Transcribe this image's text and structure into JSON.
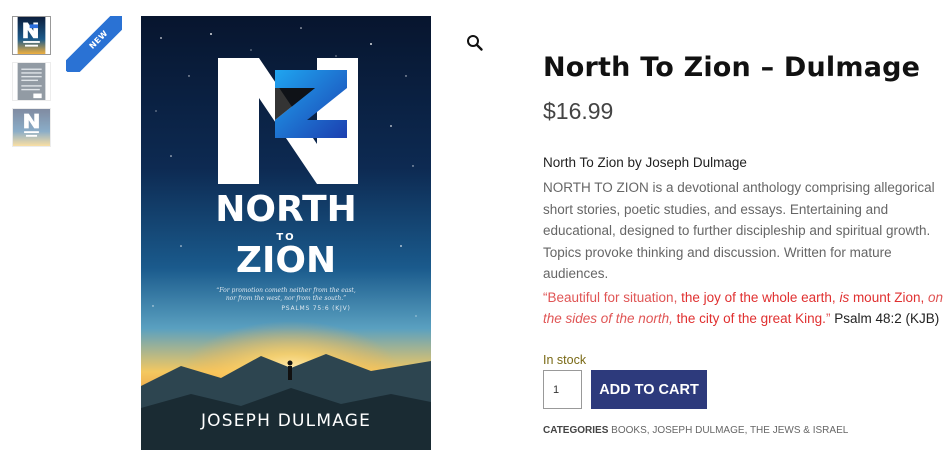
{
  "product": {
    "badge": "NEW",
    "title": "North To Zion – Dulmage",
    "price": "$16.99",
    "byline": "North To Zion by Joseph Dulmage",
    "description": "NORTH TO ZION is a devotional anthology comprising allegorical short stories, poetic studies, and essays. Entertaining and educational, designed to further discipleship and spiritual growth. Topics provoke thinking and discussion. Written for mature audiences.",
    "quote": {
      "part1": "“Beautiful for situation,",
      "part2": " the joy of the whole earth,",
      "part3": " is",
      "part4": " mount Zion,",
      "part5": " on the sides of the north,",
      "part6": " the city of the great King.",
      "part7": "”",
      "reference": " Psalm 48:2 (KJB)"
    },
    "stock": "In stock",
    "quantity": "1",
    "add_to_cart": "ADD TO CART",
    "categories_label": "CATEGORIES",
    "categories": [
      "BOOKS",
      "JOSEPH DULMAGE",
      "THE JEWS & ISRAEL"
    ]
  },
  "cover": {
    "title_line1": "NORTH",
    "title_line2": "TO",
    "title_line3": "ZION",
    "verse_line1": "“For promotion cometh neither from the east,",
    "verse_line2": "nor from the west, nor from the south.”",
    "verse_ref": "PSALMS 75:6 (KJV)",
    "author": "JOSEPH DULMAGE"
  },
  "icons": {
    "zoom": "magnifier-icon"
  },
  "colors": {
    "button": "#2d3a7c",
    "ribbon": "#2a72d4",
    "quote_red": "#e05555",
    "stock": "#7a6a16"
  }
}
